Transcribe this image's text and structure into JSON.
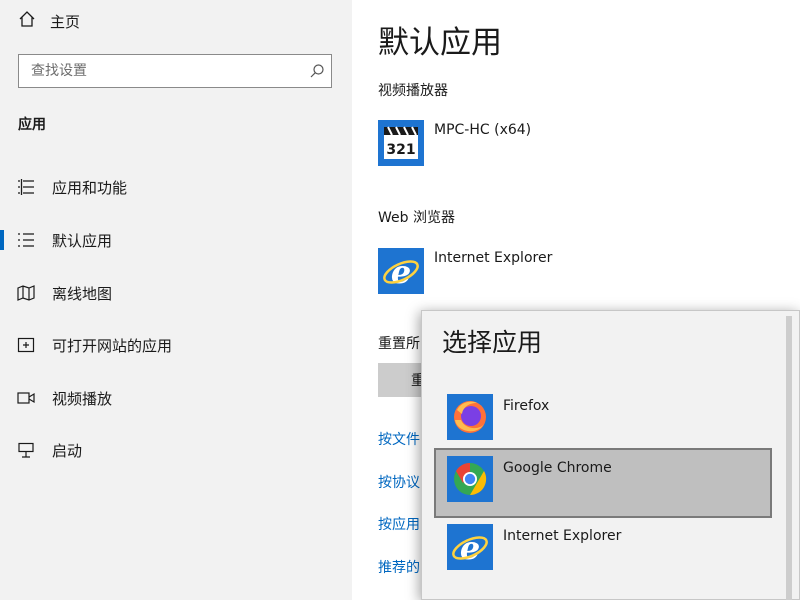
{
  "sidebar": {
    "home_label": "主页",
    "search_placeholder": "查找设置",
    "section_title": "应用",
    "items": [
      {
        "label": "应用和功能",
        "icon": "apps-list-icon"
      },
      {
        "label": "默认应用",
        "icon": "default-apps-icon",
        "active": true
      },
      {
        "label": "离线地图",
        "icon": "map-icon"
      },
      {
        "label": "可打开网站的应用",
        "icon": "web-app-icon"
      },
      {
        "label": "视频播放",
        "icon": "video-icon"
      },
      {
        "label": "启动",
        "icon": "startup-icon"
      }
    ]
  },
  "main": {
    "title": "默认应用",
    "video_label": "视频播放器",
    "video_app": "MPC-HC (x64)",
    "mpc_icon_text": "321",
    "browser_label": "Web 浏览器",
    "browser_app": "Internet Explorer",
    "reset_label": "重置所",
    "reset_button": "重",
    "links": [
      "按文件",
      "按协议",
      "按应用",
      "推荐的"
    ]
  },
  "flyout": {
    "title": "选择应用",
    "choices": [
      "Firefox",
      "Google Chrome",
      "Internet Explorer"
    ],
    "selected": "Google Chrome"
  },
  "colors": {
    "accent": "#0067c0",
    "sidebar_bg": "#f2f2f2",
    "selected_bg": "#bfbfbf"
  }
}
